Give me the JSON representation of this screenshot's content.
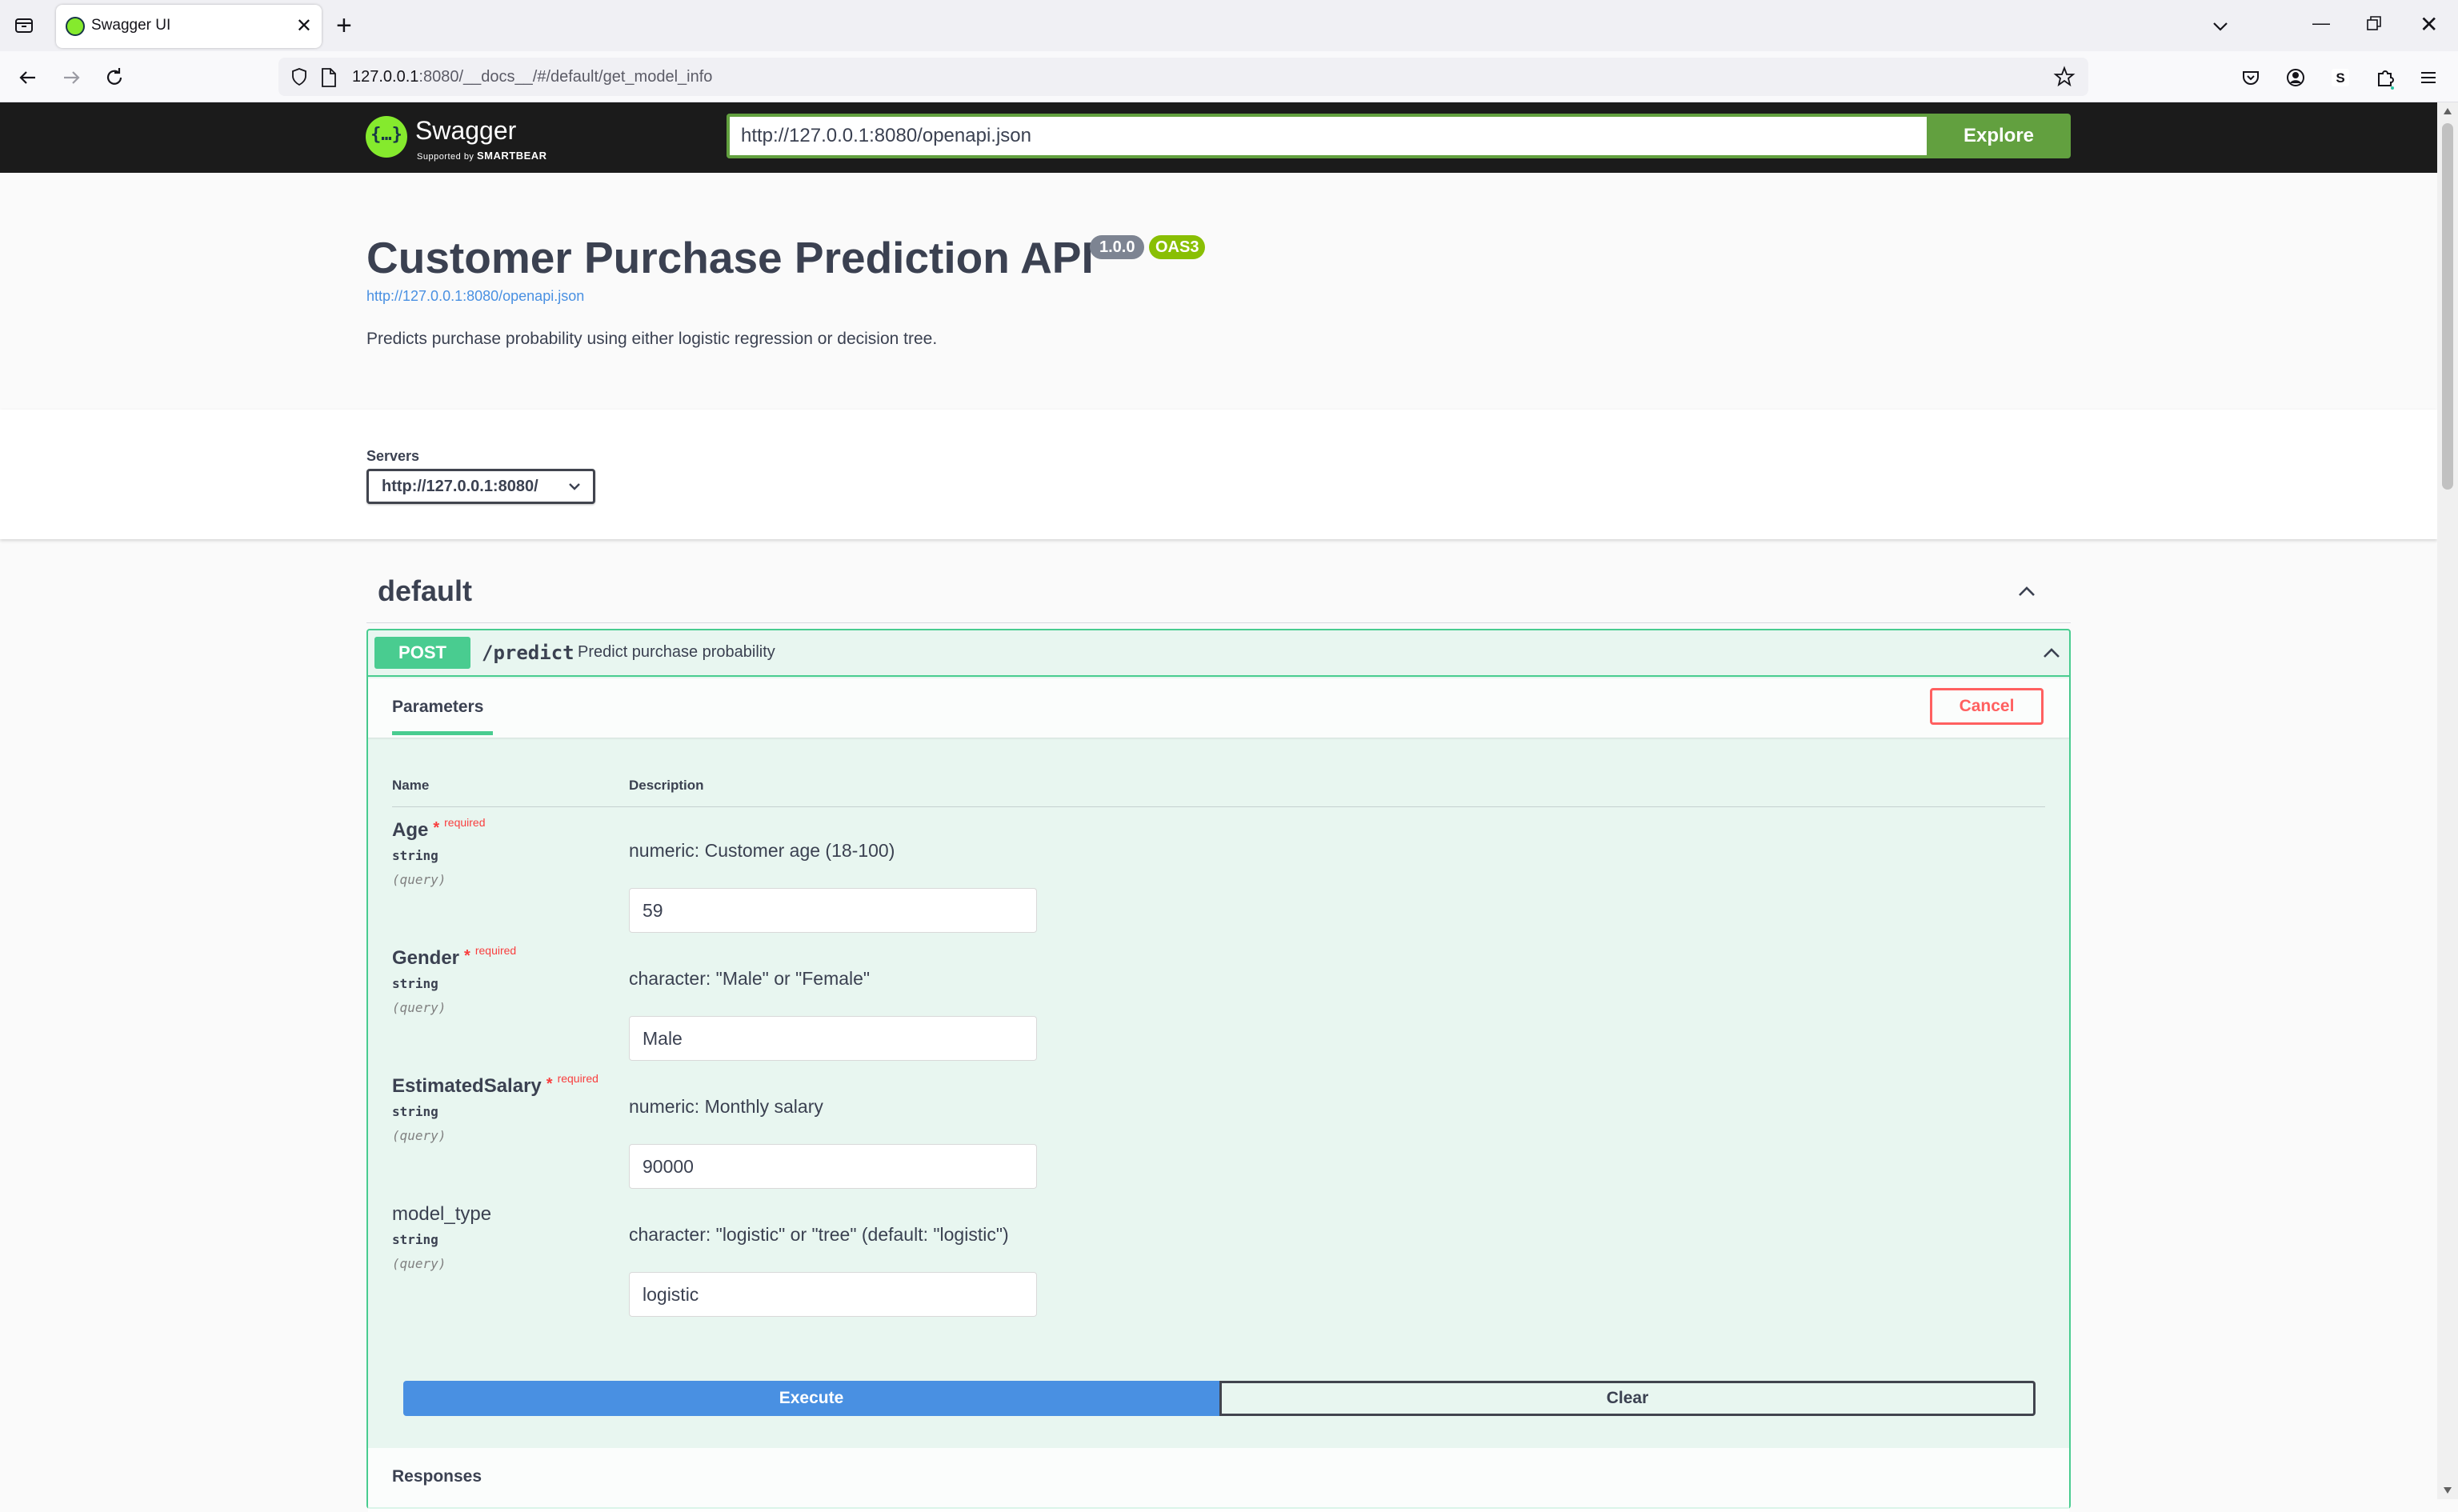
{
  "browser": {
    "tab_title": "Swagger UI",
    "url_host": "127.0.0.1",
    "url_rest": ":8080/__docs__/#/default/get_model_info"
  },
  "topbar": {
    "logo_word": "Swagger",
    "logo_sub_small": "Supported by",
    "logo_sub_brand": "SMARTBEAR",
    "spec_url": "http://127.0.0.1:8080/openapi.json",
    "explore_label": "Explore"
  },
  "info": {
    "title": "Customer Purchase Prediction API",
    "version": "1.0.0",
    "oas": "OAS3",
    "spec_link": "http://127.0.0.1:8080/openapi.json",
    "description": "Predicts purchase probability using either logistic regression or decision tree."
  },
  "servers": {
    "label": "Servers",
    "selected": "http://127.0.0.1:8080/"
  },
  "tag": {
    "name": "default"
  },
  "operation": {
    "method": "POST",
    "path": "/predict",
    "summary": "Predict purchase probability",
    "tab_label": "Parameters",
    "cancel_label": "Cancel",
    "col_name": "Name",
    "col_description": "Description",
    "required_star": "*",
    "required_text": "required",
    "params": [
      {
        "name": "Age",
        "type": "string",
        "in": "(query)",
        "description": "numeric: Customer age (18-100)",
        "value": "59",
        "required": true
      },
      {
        "name": "Gender",
        "type": "string",
        "in": "(query)",
        "description": "character: \"Male\" or \"Female\"",
        "value": "Male",
        "required": true
      },
      {
        "name": "EstimatedSalary",
        "type": "string",
        "in": "(query)",
        "description": "numeric: Monthly salary",
        "value": "90000",
        "required": true
      },
      {
        "name": "model_type",
        "type": "string",
        "in": "(query)",
        "description": "character: \"logistic\" or \"tree\" (default: \"logistic\")",
        "value": "logistic",
        "required": false
      }
    ],
    "execute_label": "Execute",
    "clear_label": "Clear",
    "responses_label": "Responses"
  },
  "colors": {
    "post_green": "#49cc90",
    "execute_blue": "#4990e2",
    "cancel_red": "#ff6060",
    "topbar_bg": "#1b1b1b",
    "explore_green": "#62a03f"
  }
}
